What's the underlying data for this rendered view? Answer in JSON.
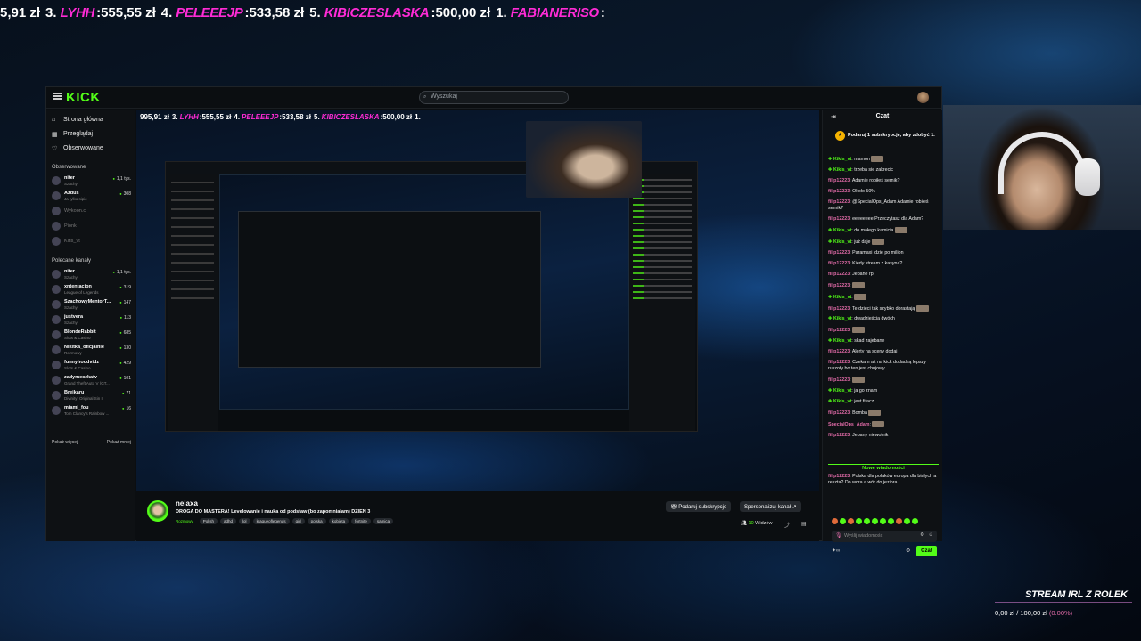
{
  "ticker": {
    "items": [
      {
        "rank": "",
        "name": "",
        "amount": "5,91 zł"
      },
      {
        "rank": "3.",
        "name": "LYHH",
        "amount": "555,55 zł"
      },
      {
        "rank": "4.",
        "name": "PELEEEJP",
        "amount": "533,58 zł"
      },
      {
        "rank": "5.",
        "name": "KIBICZESLASKA",
        "amount": "500,00 zł"
      },
      {
        "rank": "1.",
        "name": "FABIANERISO",
        "amount": ""
      }
    ]
  },
  "ticker_inner": {
    "items": [
      {
        "rank": "",
        "name": "",
        "amount": "995,91 zł"
      },
      {
        "rank": "3.",
        "name": "LYHH",
        "amount": "555,55 zł"
      },
      {
        "rank": "4.",
        "name": "PELEEEJP",
        "amount": "533,58 zł"
      },
      {
        "rank": "5.",
        "name": "KIBICZESLASKA",
        "amount": "500,00 zł"
      },
      {
        "rank": "1.",
        "name": "",
        "amount": ""
      }
    ]
  },
  "app": {
    "logo": "KICK",
    "search_placeholder": "Wyszukaj"
  },
  "nav": [
    {
      "icon": "home-icon",
      "glyph": "⌂",
      "label": "Strona główna"
    },
    {
      "icon": "browse-icon",
      "glyph": "▦",
      "label": "Przeglądaj"
    },
    {
      "icon": "heart-icon",
      "glyph": "♡",
      "label": "Obserwowane"
    }
  ],
  "followed": {
    "title": "Obserwowane",
    "channels": [
      {
        "name": "niter",
        "category": "Szachy",
        "viewers": "1,1 tys.",
        "live": true
      },
      {
        "name": "Azdus",
        "category": "Ja tylko sipię",
        "viewers": "308",
        "live": true
      },
      {
        "name": "Wykoon.ci",
        "category": "",
        "viewers": "",
        "live": false
      },
      {
        "name": "Pionk",
        "category": "",
        "viewers": "",
        "live": false
      },
      {
        "name": "Kitis_vt",
        "category": "",
        "viewers": "",
        "live": false
      }
    ]
  },
  "recommended": {
    "title": "Polecane kanały",
    "channels": [
      {
        "name": "niter",
        "category": "Szachy",
        "viewers": "1,1 tys."
      },
      {
        "name": "xntentacion",
        "category": "League of Legends",
        "viewers": "319"
      },
      {
        "name": "SzachowyMentorT...",
        "category": "Szachy",
        "viewers": "147"
      },
      {
        "name": "justvera",
        "category": "Szachy",
        "viewers": "113"
      },
      {
        "name": "BlondeRabbit",
        "category": "Slots & Casino",
        "viewers": "685"
      },
      {
        "name": "Nikitka_oficjalnie",
        "category": "Rozmowy",
        "viewers": "130"
      },
      {
        "name": "funnyhoodvidz",
        "category": "Slots & Casino",
        "viewers": "429"
      },
      {
        "name": "zadymeczkatv",
        "category": "Grand Theft Auto V (GT...",
        "viewers": "101"
      },
      {
        "name": "Brejkaru",
        "category": "Divinity: Original Sin II",
        "viewers": "71"
      },
      {
        "name": "miami_fou",
        "category": "Tom Clancy's Rainbow ...",
        "viewers": "16"
      }
    ],
    "show_more": "Pokaż więcej",
    "show_less": "Pokaż mniej"
  },
  "stream": {
    "streamer": "nelaxa",
    "title": "DROGA DO MASTERA! Levelowanie i nauka od podstaw (bo zapomniałam)  DZIEN 3",
    "category": "Rozmowy",
    "tags": [
      "Polish",
      "adhd",
      "lol",
      "leagueoflegends",
      "girl",
      "polska",
      "kobieta",
      "fortnite",
      "samica"
    ],
    "subscribe_label": "Podaruj subskrypcje",
    "sponsor_label": "Spersonalizuj kanał",
    "viewers": "10",
    "viewers_label": "Widzów"
  },
  "chat": {
    "title": "Czat",
    "sub_banner": "Podaruj 1 subskrypcję, aby zdobyć 1.",
    "messages": [
      {
        "user": "Kikis_vt",
        "color": "g",
        "badge": "✚",
        "text": "mamon",
        "emote": true
      },
      {
        "user": "Kikis_vt",
        "color": "g",
        "badge": "✚",
        "text": "trzeba sie zakrecic",
        "emote": false
      },
      {
        "user": "filip12223",
        "color": "p",
        "badge": "",
        "text": "Adamie robiłeś sernik?",
        "emote": false
      },
      {
        "user": "filip12223",
        "color": "p",
        "badge": "",
        "text": "Około 50%",
        "emote": false
      },
      {
        "user": "filip12223",
        "color": "p",
        "badge": "",
        "text": "@SpecialOps_Adam Adamie robiłeś sernik?",
        "emote": false
      },
      {
        "user": "filip12223",
        "color": "p",
        "badge": "",
        "text": "eeeeeeee Przeczytasz dla Adam?",
        "emote": false
      },
      {
        "user": "Kikis_vt",
        "color": "g",
        "badge": "✚",
        "text": "do małego kamicia",
        "emote": true
      },
      {
        "user": "Kikis_vt",
        "color": "g",
        "badge": "✚",
        "text": "już daje",
        "emote": true
      },
      {
        "user": "filip12223",
        "color": "p",
        "badge": "",
        "text": "Paramaxi idzie po milion",
        "emote": false
      },
      {
        "user": "filip12223",
        "color": "p",
        "badge": "",
        "text": "Kiedy stream z kasyna?",
        "emote": false
      },
      {
        "user": "filip12223",
        "color": "p",
        "badge": "",
        "text": "Jebane rp",
        "emote": false
      },
      {
        "user": "filip12223",
        "color": "p",
        "badge": "",
        "text": "",
        "emote": true
      },
      {
        "user": "Kikis_vt",
        "color": "g",
        "badge": "✚",
        "text": "",
        "emote": true
      },
      {
        "user": "filip12223",
        "color": "p",
        "badge": "",
        "text": "Te dzieci tak szybko dorastają",
        "emote": true
      },
      {
        "user": "Kikis_vt",
        "color": "g",
        "badge": "✚",
        "text": "dwadzieścia dwóch",
        "emote": false
      },
      {
        "user": "filip12223",
        "color": "p",
        "badge": "",
        "text": "",
        "emote": true
      },
      {
        "user": "Kikis_vt",
        "color": "g",
        "badge": "✚",
        "text": "skad zajebane",
        "emote": false
      },
      {
        "user": "filip12223",
        "color": "p",
        "badge": "",
        "text": "Alerty na sceny dodaj",
        "emote": false
      },
      {
        "user": "filip12223",
        "color": "p",
        "badge": "",
        "text": "Czekam aż na kick dodadzą lepszy ruszofy bo ten jest chujowy",
        "emote": false
      },
      {
        "user": "filip12223",
        "color": "p",
        "badge": "",
        "text": "",
        "emote": true
      },
      {
        "user": "Kikis_vt",
        "color": "g",
        "badge": "✚",
        "text": "ja go znam",
        "emote": false
      },
      {
        "user": "Kikis_vt",
        "color": "g",
        "badge": "✚",
        "text": "jest fifacz",
        "emote": false
      },
      {
        "user": "filip12223",
        "color": "p",
        "badge": "",
        "text": "Bomba",
        "emote": true
      },
      {
        "user": "SpecialOps_Adam",
        "color": "p",
        "badge": "",
        "text": "",
        "emote": true
      },
      {
        "user": "filip12223",
        "color": "p",
        "badge": "",
        "text": "Jebany niewolnik",
        "emote": false
      }
    ],
    "new_messages": "Nowe wiadomości",
    "last_message": {
      "user": "filip12223",
      "text": "Polska dla polaków europa dla białych a reszta? Do wora a wór do jeziora"
    },
    "input_placeholder": "Wyślij wiadomość",
    "infinity": "∞",
    "send_label": "Czat"
  },
  "goal": {
    "title": "STREAM IRL Z ROLEK",
    "current": "0,00 zł",
    "target": "100,00 zł",
    "percent": "(0.00%)"
  }
}
